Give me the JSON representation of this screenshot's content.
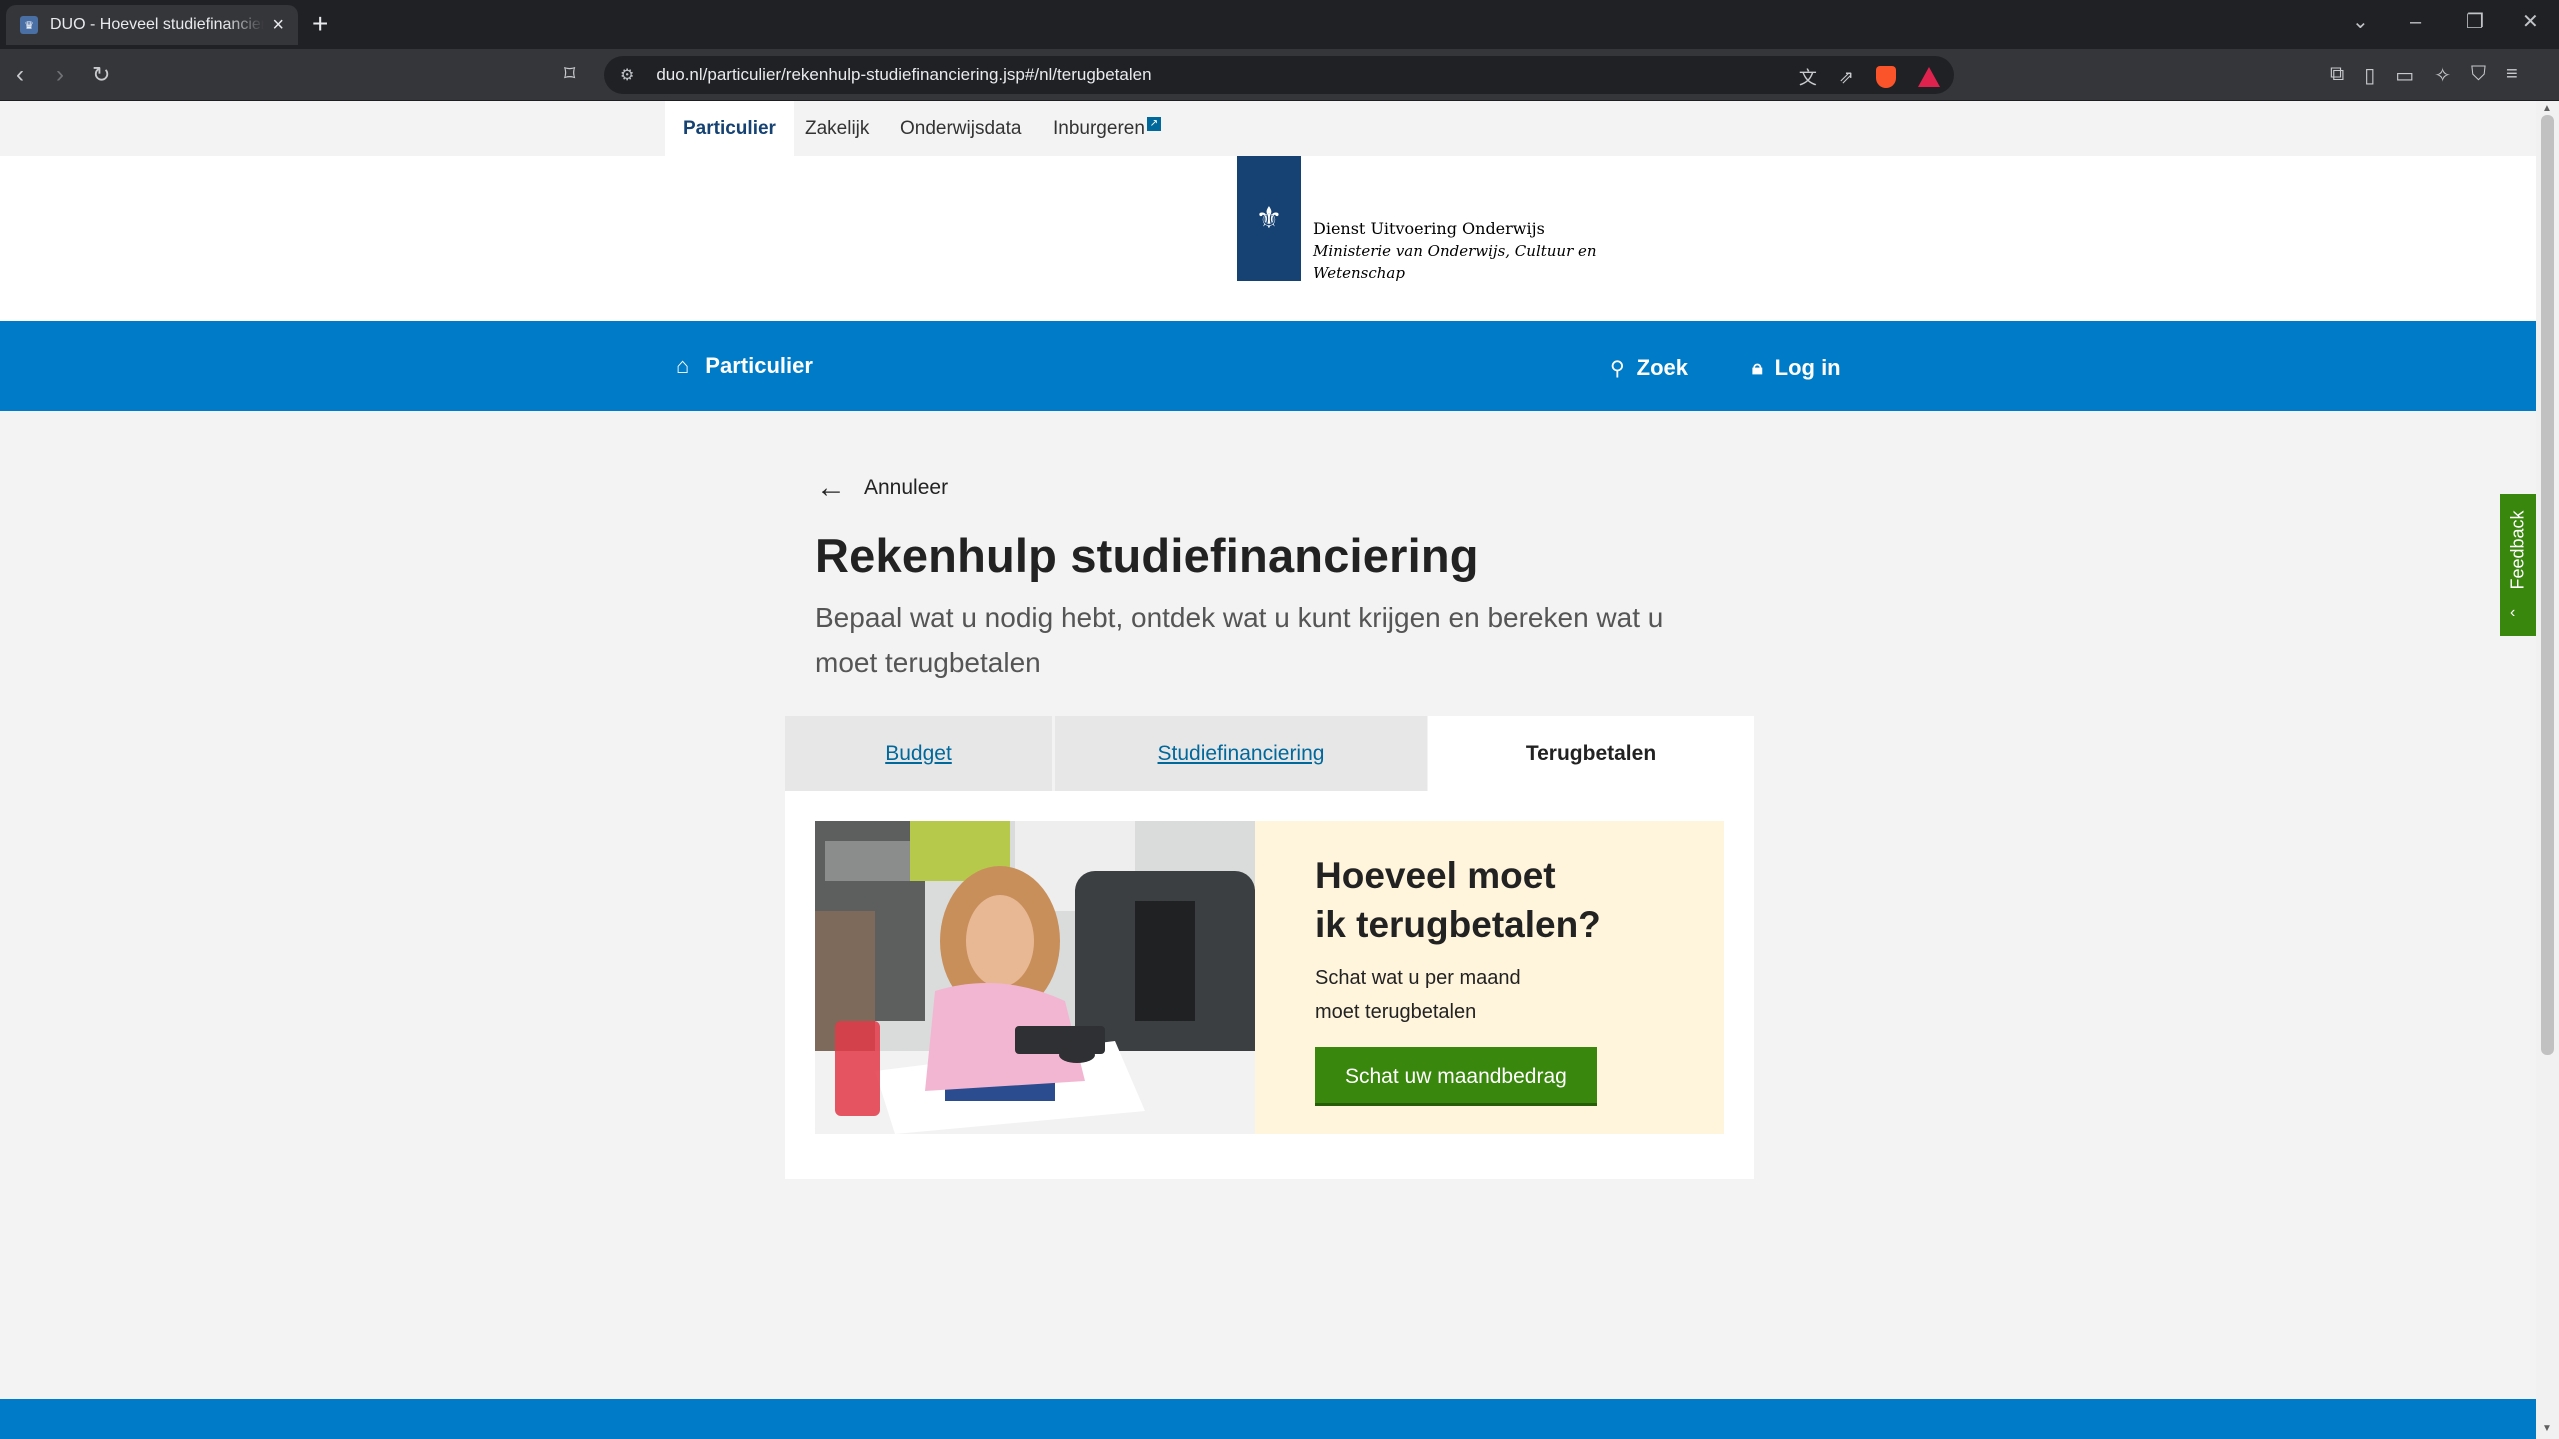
{
  "browser": {
    "tab_title": "DUO - Hoeveel studiefinanciering",
    "url": "duo.nl/particulier/rekenhulp-studiefinanciering.jsp#/nl/terugbetalen"
  },
  "topnav": {
    "items": [
      "Particulier",
      "Zakelijk",
      "Onderwijsdata",
      "Inburgeren"
    ]
  },
  "logo": {
    "line1": "Dienst Uitvoering Onderwijs",
    "line2": "Ministerie van Onderwijs, Cultuur en",
    "line3": "Wetenschap"
  },
  "mainbar": {
    "home_label": "Particulier",
    "search_label": "Zoek",
    "login_label": "Log in"
  },
  "content": {
    "back_label": "Annuleer",
    "title": "Rekenhulp studiefinanciering",
    "subtitle": "Bepaal wat u nodig hebt, ontdek wat u kunt krijgen en bereken wat u moet terugbetalen",
    "tabs": [
      "Budget",
      "Studiefinanciering",
      "Terugbetalen"
    ],
    "promo": {
      "title_line1": "Hoeveel moet",
      "title_line2": "ik terugbetalen?",
      "desc": "Schat wat u per maand moet terugbetalen",
      "button": "Schat uw maandbedrag"
    }
  },
  "feedback_label": "Feedback",
  "colors": {
    "brand_blue": "#007bc7",
    "logo_blue": "#154273",
    "link_blue": "#01689b",
    "green": "#39870c",
    "promo_bg": "#fff4dc"
  }
}
